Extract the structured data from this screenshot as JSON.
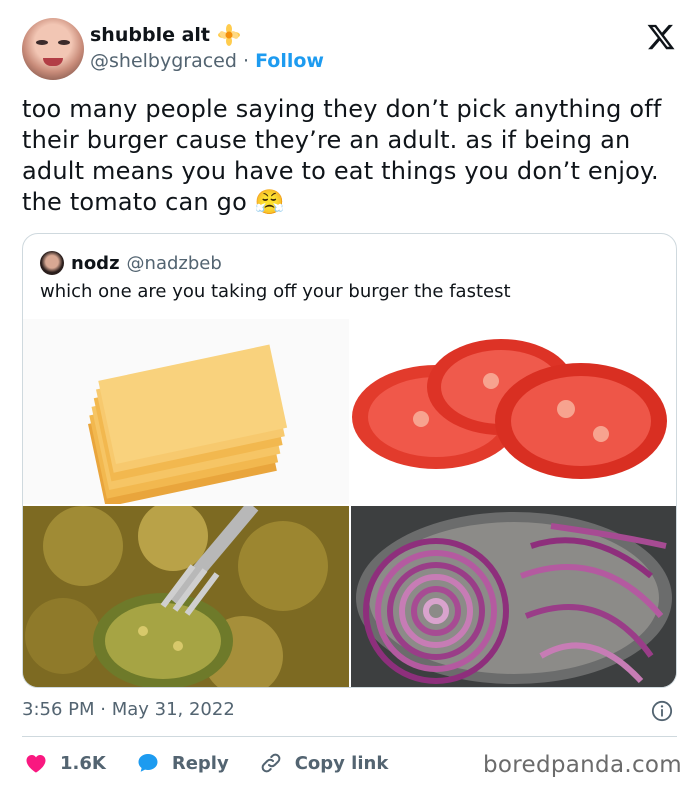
{
  "author": {
    "display_name": "shubble alt",
    "handle": "@shelbygraced",
    "separator": "·",
    "follow_label": "Follow",
    "flower_emoji": "🌼"
  },
  "tweet": {
    "text": "too many people saying they don’t pick anything off their burger cause they’re an adult. as if being an adult means you have to eat things you don’t enjoy. the tomato can go 😤"
  },
  "quoted_tweet": {
    "display_name": "nodz",
    "handle": "@nadzbeb",
    "text": "which one are you taking off your burger the fastest",
    "images": [
      "cheese-slices",
      "tomato-slices",
      "pickles",
      "red-onion"
    ]
  },
  "meta": {
    "timestamp": "3:56 PM · May 31, 2022"
  },
  "actions": {
    "like_count": "1.6K",
    "reply_label": "Reply",
    "copy_link_label": "Copy link"
  },
  "watermark": "boredpanda.com",
  "colors": {
    "accent": "#1d9bf0",
    "like": "#f91880",
    "text": "#0f1419",
    "secondary": "#536471",
    "border": "#cfd9de"
  }
}
